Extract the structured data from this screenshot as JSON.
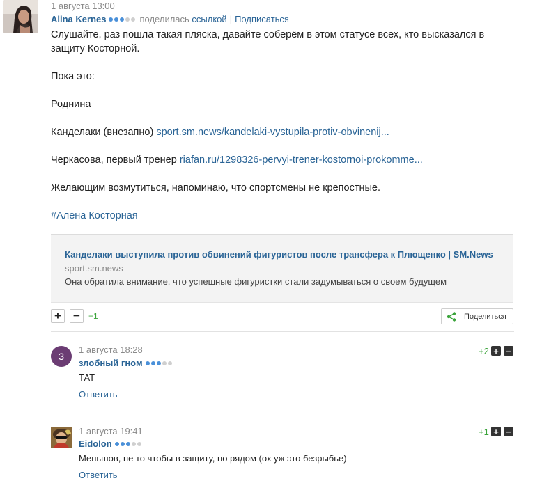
{
  "post": {
    "time": "1 августа 13:00",
    "author": "Alina Kernes",
    "author_dots": 3,
    "shared_prefix": "поделилась",
    "shared_link": "ссылкой",
    "separator": "|",
    "subscribe": "Подписаться",
    "paragraphs": {
      "p1": "Слушайте, раз пошла такая пляска, давайте соберём в этом статусе всех, кто высказался в защиту Косторной.",
      "p2": "Пока это:",
      "p3": "Роднина",
      "p4_text": "Канделаки (внезапно) ",
      "p4_link": "sport.sm.news/kandelaki-vystupila-protiv-obvinenij...",
      "p5_text": "Черкасова, первый тренер ",
      "p5_link": "riafan.ru/1298326-pervyi-trener-kostornoi-prokomme...",
      "p6": "Желающим возмутиться, напоминаю, что спортсмены не крепостные.",
      "p7_tag": "#Алена Косторная"
    },
    "link_card": {
      "title": "Канделаки выступила против обвинений фигуристов после трансфера к Плющенко | SM.News",
      "domain": "sport.sm.news",
      "description": "Она обратила внимание, что успешные фигуристки стали задумываться о своем будущем"
    },
    "vote_plus": "+",
    "vote_minus": "−",
    "score": "+1",
    "share_label": "Поделиться"
  },
  "comments": [
    {
      "avatar_letter": "З",
      "time": "1 августа 18:28",
      "author": "злобный гном",
      "author_dots": 3,
      "text": "ТАТ",
      "reply": "Ответить",
      "score": "+2"
    },
    {
      "time": "1 августа 19:41",
      "author": "Eidolon",
      "author_dots": 3,
      "text": "Меньшов, не то чтобы в защиту, но рядом (ох уж это безрыбье)",
      "reply": "Ответить",
      "score": "+1"
    }
  ],
  "mini_plus": "+",
  "mini_minus": "−",
  "colors": {
    "link": "#2a6496",
    "score_green": "#3aa33a",
    "comment_avatar_bg": "#6b3c73"
  }
}
